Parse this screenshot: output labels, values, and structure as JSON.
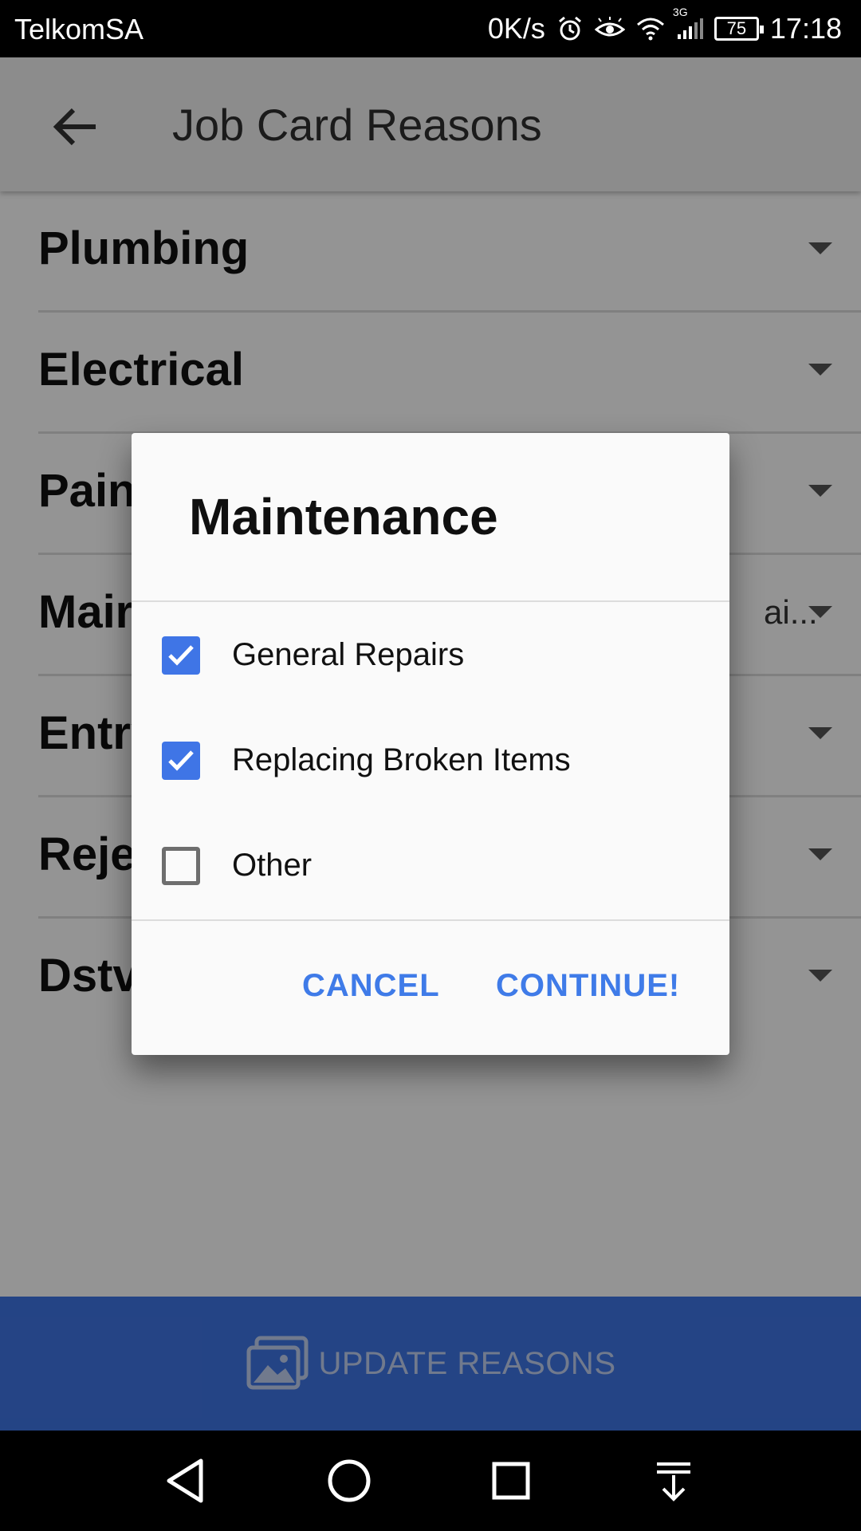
{
  "status_bar": {
    "carrier": "TelkomSA",
    "speed": "0K/s",
    "network": "3G",
    "battery": "75",
    "time": "17:18",
    "icons": [
      "alarm-icon",
      "eye-icon",
      "wifi-icon",
      "signal-icon",
      "battery-icon"
    ]
  },
  "app_bar": {
    "title": "Job Card Reasons",
    "back_icon": "arrow-back-icon"
  },
  "list": {
    "items": [
      {
        "label": "Plumbing",
        "sub": ""
      },
      {
        "label": "Electrical",
        "sub": ""
      },
      {
        "label": "Pain",
        "sub": ""
      },
      {
        "label": "Mair",
        "sub": "ai..."
      },
      {
        "label": "Entry",
        "sub": ""
      },
      {
        "label": "Reje",
        "sub": ""
      },
      {
        "label": "Dstv",
        "sub": ""
      }
    ]
  },
  "dialog": {
    "title": "Maintenance",
    "options": [
      {
        "label": "General Repairs",
        "checked": true
      },
      {
        "label": "Replacing Broken Items",
        "checked": true
      },
      {
        "label": "Other",
        "checked": false
      }
    ],
    "cancel_label": "CANCEL",
    "continue_label": "CONTINUE!"
  },
  "bottom_bar": {
    "label": "UPDATE REASONS",
    "icon": "images-icon"
  },
  "nav_bar": {
    "icons": [
      "back-triangle-icon",
      "home-circle-icon",
      "recents-square-icon",
      "notification-pull-icon"
    ]
  },
  "colors": {
    "accent": "#3f75e6",
    "dialog_button": "#3f7be8",
    "scrim": "rgba(0,0,0,0.42)"
  }
}
